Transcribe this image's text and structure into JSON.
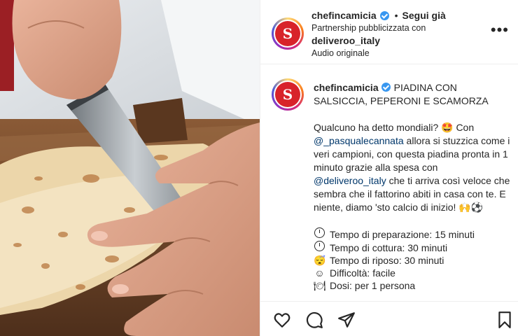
{
  "header": {
    "username": "chefincamicia",
    "separator": "•",
    "follow_label": "Segui già",
    "partnership_text": "Partnership pubblicizzata con",
    "partner_name": "deliveroo_italy",
    "audio_label": "Audio originale",
    "more_label": "•••"
  },
  "avatar": {
    "logo_letter": "S",
    "brand_color": "#d8232a"
  },
  "caption": {
    "username": "chefincamicia",
    "title": "PIADINA CON SALSICCIA, PEPERONI E SCAMORZA",
    "p1_a": "Qualcuno ha detto mondiali? 🤩 Con ",
    "mention1": "@_pasqualecannata",
    "p1_b": " allora si stuzzica come i veri campioni, con questa piadina pronta in 1 minuto grazie alla spesa con ",
    "mention2": "@deliveroo_italy",
    "p1_c": " che ti arriva così veloce che sembra che il fattorino abiti in casa con te. E niente, diamo 'sto calcio di inizio! 🙌⚽",
    "details": [
      {
        "icon": "clock-icon",
        "text": "Tempo di preparazione: 15 minuti"
      },
      {
        "icon": "clock-icon",
        "text": "Tempo di cottura: 30 minuti"
      },
      {
        "icon": "sleepy-face-icon",
        "glyph": "😴",
        "text": "Tempo di riposo: 30 minuti"
      },
      {
        "icon": "smiley-icon",
        "glyph": "☺",
        "text": "Difficoltà: facile"
      },
      {
        "icon": "plate-icon",
        "glyph": "🍽",
        "text": "Dosi: per 1 persona"
      }
    ]
  },
  "colors": {
    "verified": "#3897f0",
    "mention": "#00376b",
    "text": "#262626"
  },
  "actions": [
    "heart-icon",
    "comment-icon",
    "share-icon",
    "bookmark-icon"
  ]
}
